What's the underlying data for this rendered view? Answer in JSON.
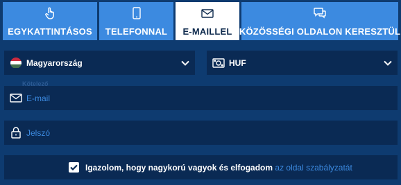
{
  "tabs": [
    {
      "label": "EGYKATTINTÁSOS",
      "icon": "pointer-hand-icon"
    },
    {
      "label": "TELEFONNAL",
      "icon": "mobile-phone-icon"
    },
    {
      "label": "E-MAILLEL",
      "icon": "envelope-icon",
      "active": true
    },
    {
      "label": "KÖZÖSSÉGI OLDALON KERESZTÜL",
      "icon": "chat-bubbles-icon"
    }
  ],
  "country": {
    "value": "Magyarország",
    "icon": "hungary-flag-icon"
  },
  "currency": {
    "value": "HUF",
    "icon": "currency-icon"
  },
  "email": {
    "placeholder": "E-mail",
    "icon": "envelope-icon"
  },
  "password": {
    "placeholder": "Jelszó",
    "icon": "lock-icon"
  },
  "consent": {
    "text": "Igazolom, hogy nagykorú vagyok és elfogadom",
    "link": "az oldal szabályzatát",
    "checked": true
  },
  "hint": "Kötelező",
  "colors": {
    "background": "#0e3b70",
    "field": "#0a2a54",
    "accent": "#3c8ae0",
    "active_tab": "#ffffff"
  }
}
